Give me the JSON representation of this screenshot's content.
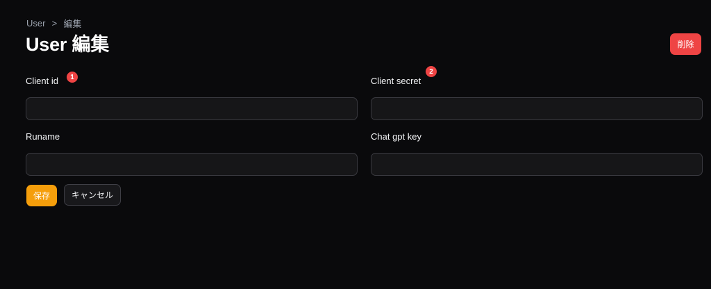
{
  "breadcrumb": {
    "items": [
      "User",
      "編集"
    ],
    "separator": ">"
  },
  "header": {
    "title": "User 編集",
    "delete_label": "削除"
  },
  "form": {
    "fields": [
      {
        "label": "Client id",
        "value": "",
        "badge": "1"
      },
      {
        "label": "Client secret",
        "value": "",
        "badge": "2"
      },
      {
        "label": "Runame",
        "value": ""
      },
      {
        "label": "Chat gpt key",
        "value": ""
      }
    ],
    "save_label": "保存",
    "cancel_label": "キャンセル"
  },
  "colors": {
    "background": "#0a0a0c",
    "danger": "#ef4444",
    "primary": "#f59e0b",
    "input_bg": "#161618",
    "input_border": "#3a3a40"
  }
}
